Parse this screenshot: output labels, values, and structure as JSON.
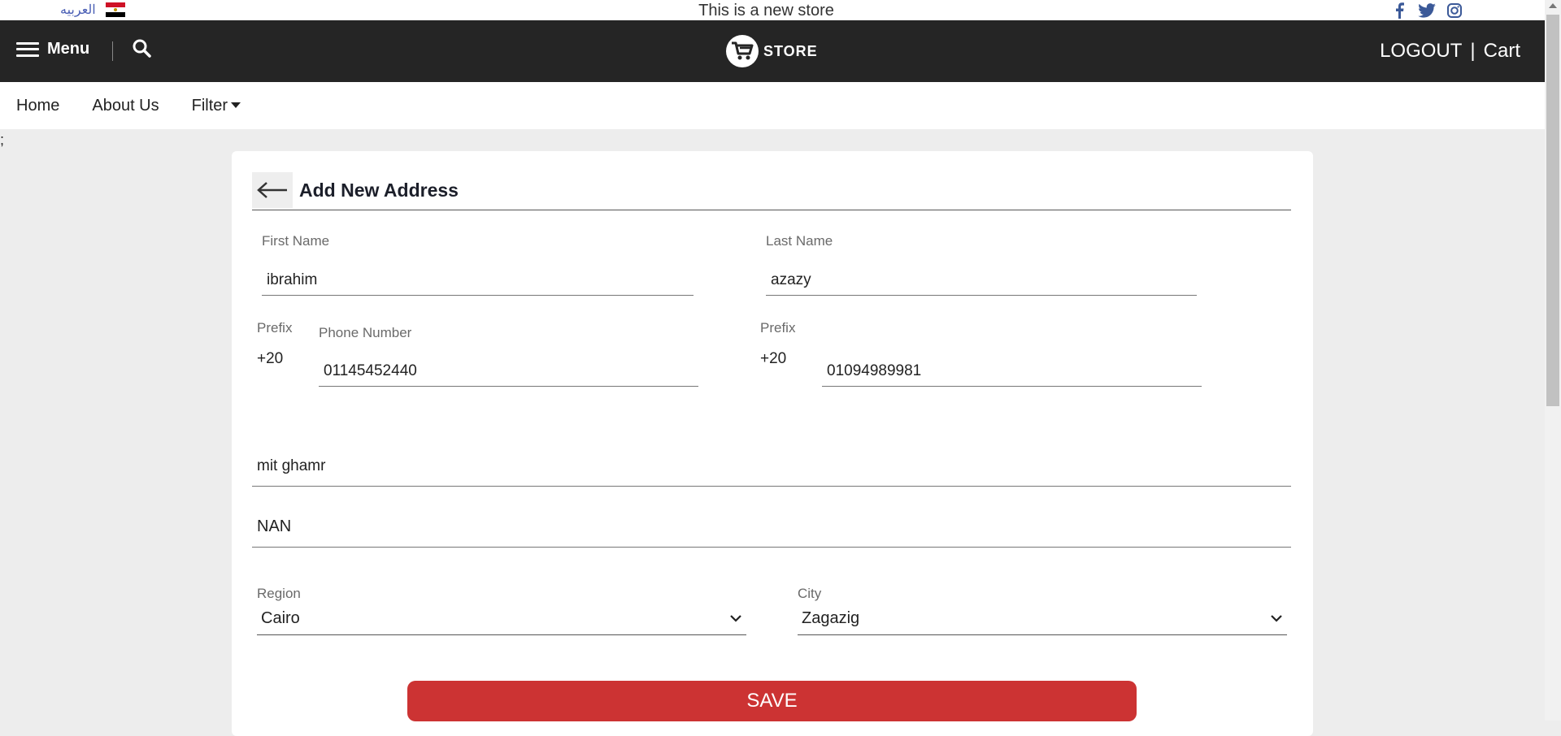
{
  "topbar": {
    "language_label": "العربيه",
    "announcement": "This is a new store",
    "social_icons": [
      "facebook-icon",
      "twitter-icon",
      "instagram-icon"
    ]
  },
  "header": {
    "menu_label": "Menu",
    "logo_text": "STORE",
    "logout_label": "LOGOUT",
    "separator": "|",
    "cart_label": "Cart"
  },
  "nav": {
    "items": [
      "Home",
      "About Us",
      "Filter"
    ]
  },
  "stray_text": ";",
  "form": {
    "title": "Add New Address",
    "first_name_label": "First Name",
    "first_name_value": "ibrahim",
    "last_name_label": "Last Name",
    "last_name_value": "azazy",
    "prefix_label": "Prefix",
    "prefix_value": "+20",
    "phone_label": "Phone Number",
    "phone_value": "01145452440",
    "prefix2_label": "Prefix",
    "prefix2_value": "+20",
    "phone2_value": "01094989981",
    "address_value": "mit ghamr",
    "address2_value": "NAN",
    "region_label": "Region",
    "region_value": "Cairo",
    "city_label": "City",
    "city_value": "Zagazig",
    "save_label": "SAVE"
  },
  "colors": {
    "header_bg": "#252525",
    "save_bg": "#cc3333",
    "link_blue": "#4a5fb5",
    "page_bg": "#ededed"
  }
}
